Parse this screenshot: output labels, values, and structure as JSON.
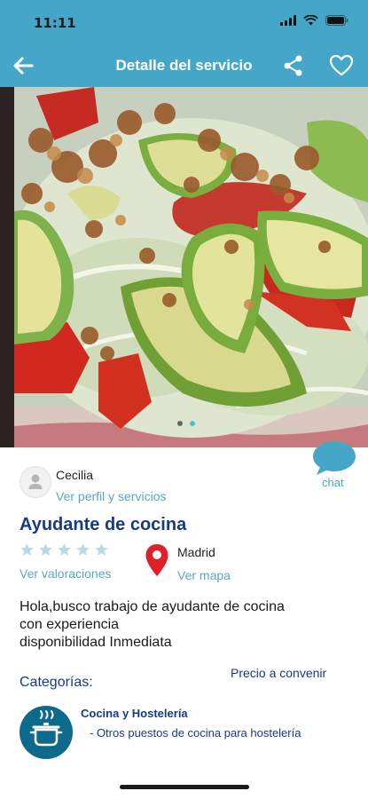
{
  "status_bar": {
    "time": "11:11"
  },
  "topbar": {
    "title": "Detalle del servicio"
  },
  "gallery": {
    "image": "salad-photo",
    "page_count": 2,
    "active_index": 1
  },
  "chat": {
    "label": "chat"
  },
  "provider": {
    "name": "Cecilia",
    "profile_link": "Ver perfil y servicios"
  },
  "service": {
    "title": "Ayudante de cocina",
    "rating_stars": 5,
    "rating_value": 0,
    "ratings_link": "Ver valoraciones",
    "location": "Madrid",
    "map_link": "Ver mapa",
    "description": "Hola,busco trabajo de ayudante de cocina\ncon experiencia\ndisponibilidad Inmediata",
    "categories_label": "Categorías:",
    "price": "Precio a convenir"
  },
  "category": {
    "name": "Cocina y Hostelería",
    "subcategory": "- Otros puestos de cocina para hostelería",
    "icon": "cooking-pot-icon"
  },
  "colors": {
    "header": "#46a6c8",
    "link": "#5aa6c8",
    "title": "#173a86",
    "pin": "#e01f2b",
    "category_icon_bg": "#0e6a8a",
    "star_empty": "#b6dbe8"
  }
}
